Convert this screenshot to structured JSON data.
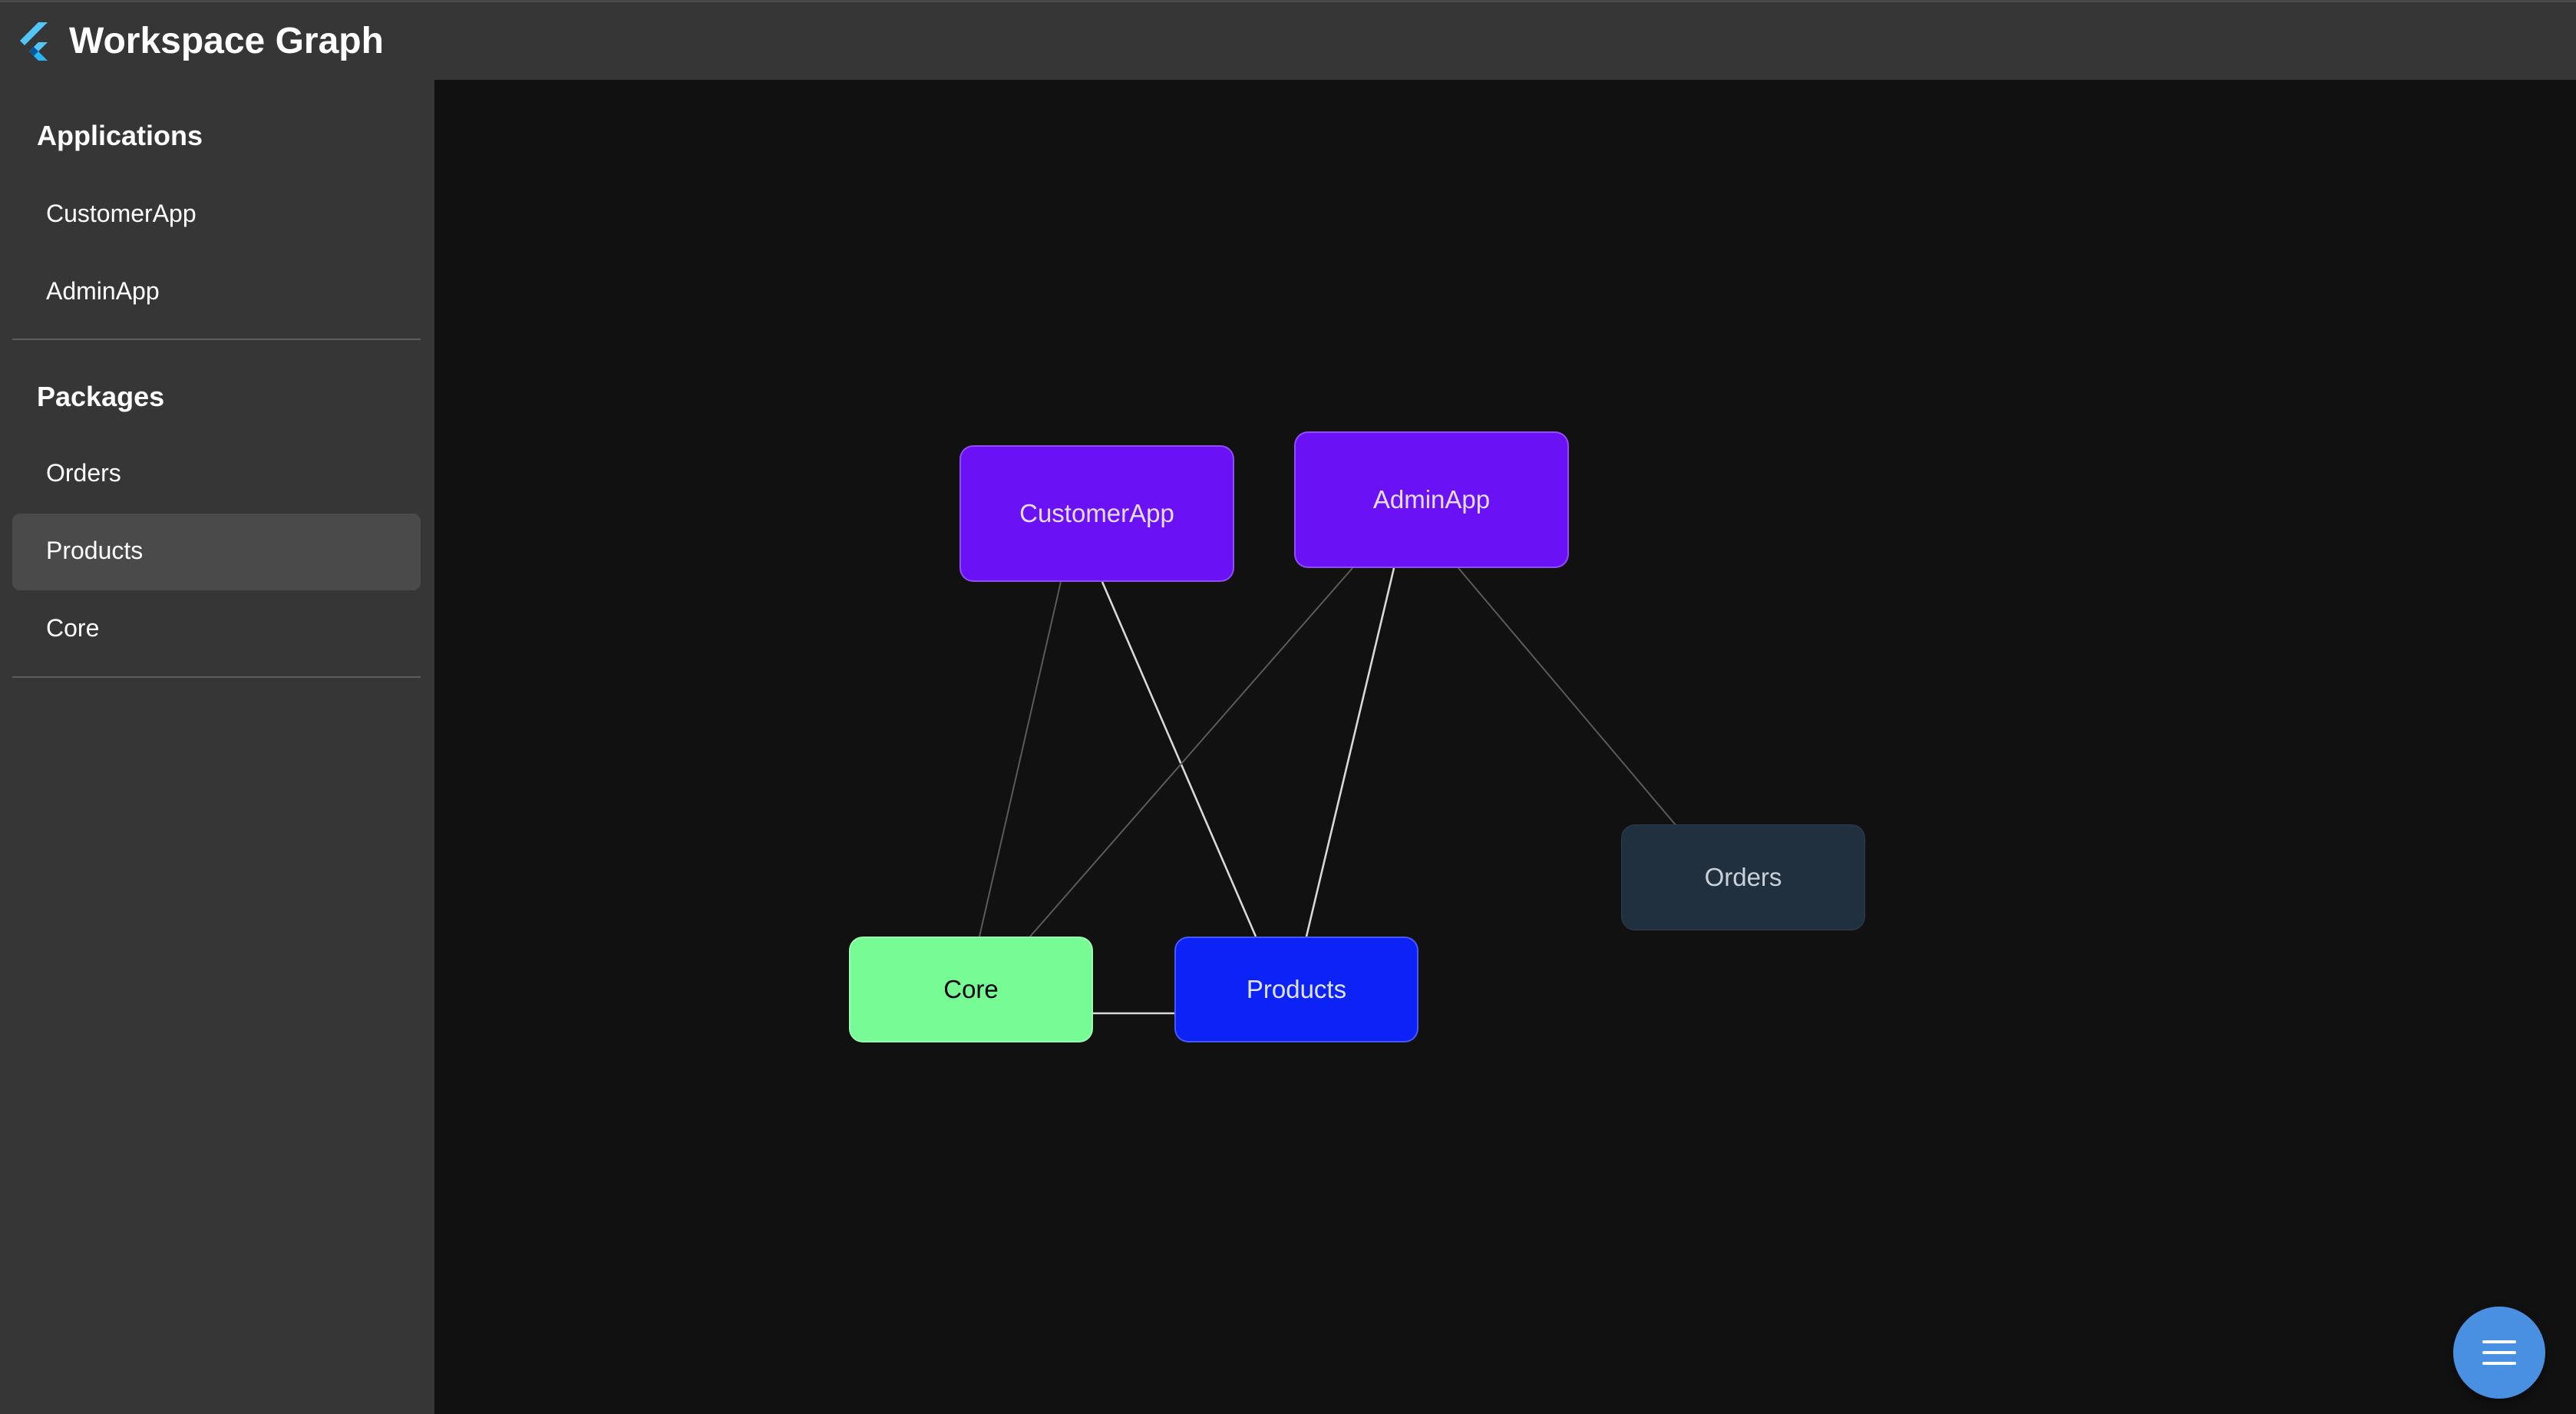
{
  "app": {
    "title": "Workspace Graph",
    "logo_icon": "flutter-logo-icon"
  },
  "sidebar": {
    "sections": [
      {
        "heading": "Applications",
        "items": [
          {
            "label": "CustomerApp",
            "selected": false
          },
          {
            "label": "AdminApp",
            "selected": false
          }
        ]
      },
      {
        "heading": "Packages",
        "items": [
          {
            "label": "Orders",
            "selected": false
          },
          {
            "label": "Products",
            "selected": true
          },
          {
            "label": "Core",
            "selected": false
          }
        ]
      }
    ]
  },
  "graph": {
    "nodes": [
      {
        "id": "customerapp",
        "label": "CustomerApp",
        "kind": "application",
        "fill": "#6a11f5",
        "text_color": "#e4dcfc"
      },
      {
        "id": "adminapp",
        "label": "AdminApp",
        "kind": "application",
        "fill": "#6a11f5",
        "text_color": "#e4dcfc"
      },
      {
        "id": "orders",
        "label": "Orders",
        "kind": "package",
        "fill": "#21303f",
        "text_color": "#c9d0d8",
        "dimmed": true
      },
      {
        "id": "core",
        "label": "Core",
        "kind": "package",
        "fill": "#77fb95",
        "text_color": "#000000"
      },
      {
        "id": "products",
        "label": "Products",
        "kind": "package",
        "fill": "#0c22f6",
        "text_color": "#dfe3ff",
        "selected": true
      }
    ],
    "edges": [
      {
        "from": "customerapp",
        "to": "core",
        "emphasis": "dim"
      },
      {
        "from": "customerapp",
        "to": "products",
        "emphasis": "bright"
      },
      {
        "from": "adminapp",
        "to": "core",
        "emphasis": "dim"
      },
      {
        "from": "adminapp",
        "to": "products",
        "emphasis": "bright"
      },
      {
        "from": "adminapp",
        "to": "orders",
        "emphasis": "dim"
      },
      {
        "from": "core",
        "to": "products",
        "emphasis": "bright"
      }
    ]
  },
  "fab": {
    "icon": "menu-icon"
  }
}
